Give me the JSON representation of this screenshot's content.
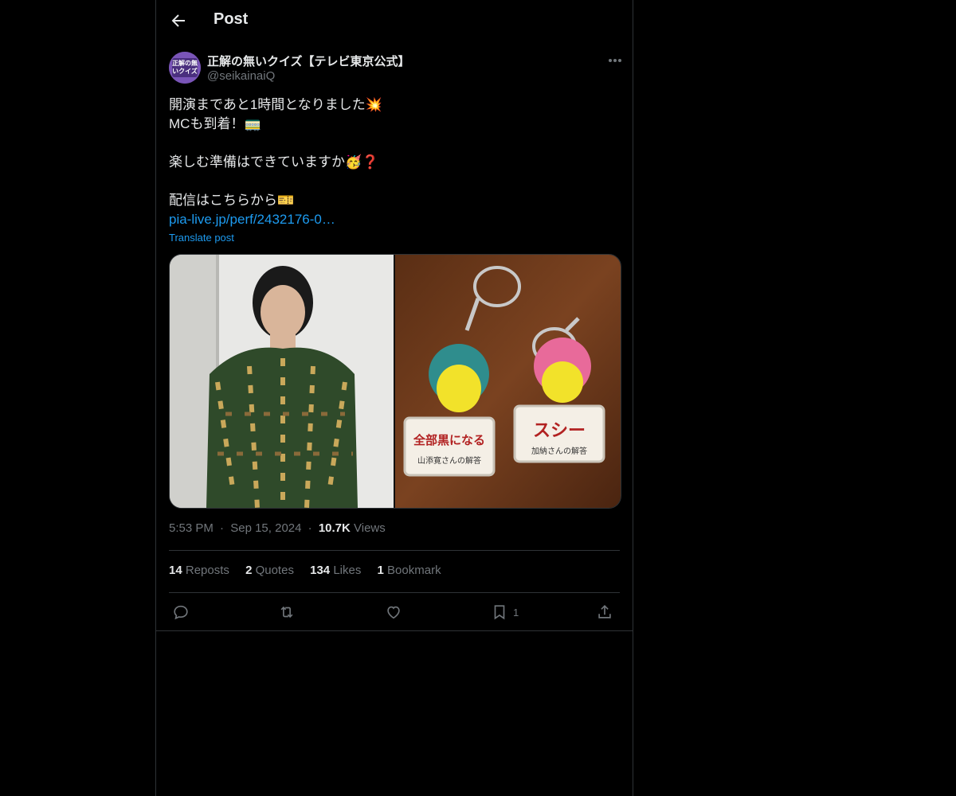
{
  "header": {
    "title": "Post"
  },
  "author": {
    "display_name": "正解の無いクイズ【テレビ東京公式】",
    "handle": "@seikainaiQ",
    "avatar_text": "正解の無いクイズ"
  },
  "post": {
    "lines": [
      "開演まであと1時間となりました💥",
      "MCも到着！🚃",
      "",
      "楽しむ準備はできていますか🥳❓",
      "",
      "配信はこちらから🎫"
    ],
    "link": "pia-live.jp/perf/2432176-0…",
    "translate": "Translate post"
  },
  "media": {
    "keychain_left_top": "全部黒になる",
    "keychain_left_bottom": "山添寛さんの解答",
    "keychain_right_top": "スシー",
    "keychain_right_bottom": "加納さんの解答"
  },
  "meta": {
    "time": "5:53 PM",
    "date": "Sep 15, 2024",
    "views_count": "10.7K",
    "views_label": "Views",
    "sep": "·"
  },
  "stats": {
    "reposts_count": "14",
    "reposts_label": "Reposts",
    "quotes_count": "2",
    "quotes_label": "Quotes",
    "likes_count": "134",
    "likes_label": "Likes",
    "bookmarks_count": "1",
    "bookmarks_label": "Bookmark"
  },
  "actions": {
    "bookmark_count": "1"
  },
  "icons": [
    "back-arrow-icon",
    "more-icon",
    "reply-icon",
    "repost-icon",
    "like-icon",
    "bookmark-icon",
    "share-icon"
  ]
}
